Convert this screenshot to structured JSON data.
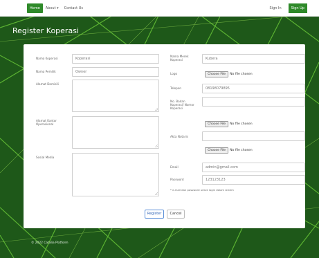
{
  "nav": {
    "home": "Home",
    "about": "About ▾",
    "contact": "Contact Us",
    "signin": "Sign In",
    "signup": "Sign Up"
  },
  "page": {
    "title": "Register Koperasi"
  },
  "form": {
    "nama_koperasi": {
      "label": "Nama Koperasi",
      "value": "Koperasi"
    },
    "nama_pemilik": {
      "label": "Nama Pemilik",
      "value": "Owner"
    },
    "alamat_domisili": {
      "label": "Alamat Domisili"
    },
    "alamat_kantor": {
      "label": "Alamat Kantor Operasional"
    },
    "sosial_media": {
      "label": "Sosial Media"
    },
    "nama_merek": {
      "label": "Nama Merek Koperasi",
      "value": "Kubera"
    },
    "logo": {
      "label": "Logo",
      "button": "Choose File",
      "status": "No file chosen"
    },
    "telepon": {
      "label": "Telepon",
      "value": "08198079895"
    },
    "no_badan": {
      "label": "No. Badan Koperasi/ Nomor Koperasi",
      "value": ""
    },
    "file2": {
      "button": "Choose File",
      "status": "No file chosen"
    },
    "akta": {
      "label": "Akta Notaris",
      "value": ""
    },
    "file3": {
      "button": "Choose File",
      "status": "No file chosen"
    },
    "email": {
      "label": "Email",
      "value": "admin@gmail.com"
    },
    "password": {
      "label": "Password",
      "value": "123123123"
    },
    "note": "* e-mail dan password untuk login dalam sistem",
    "register_button": "Register",
    "cancel_button": "Cancel"
  },
  "footer": {
    "text": "© 2022 Catalia Platform"
  },
  "colors": {
    "background": "#1f5a1a",
    "accent": "#2f8a2a",
    "primary_button": "#2f64b5"
  }
}
